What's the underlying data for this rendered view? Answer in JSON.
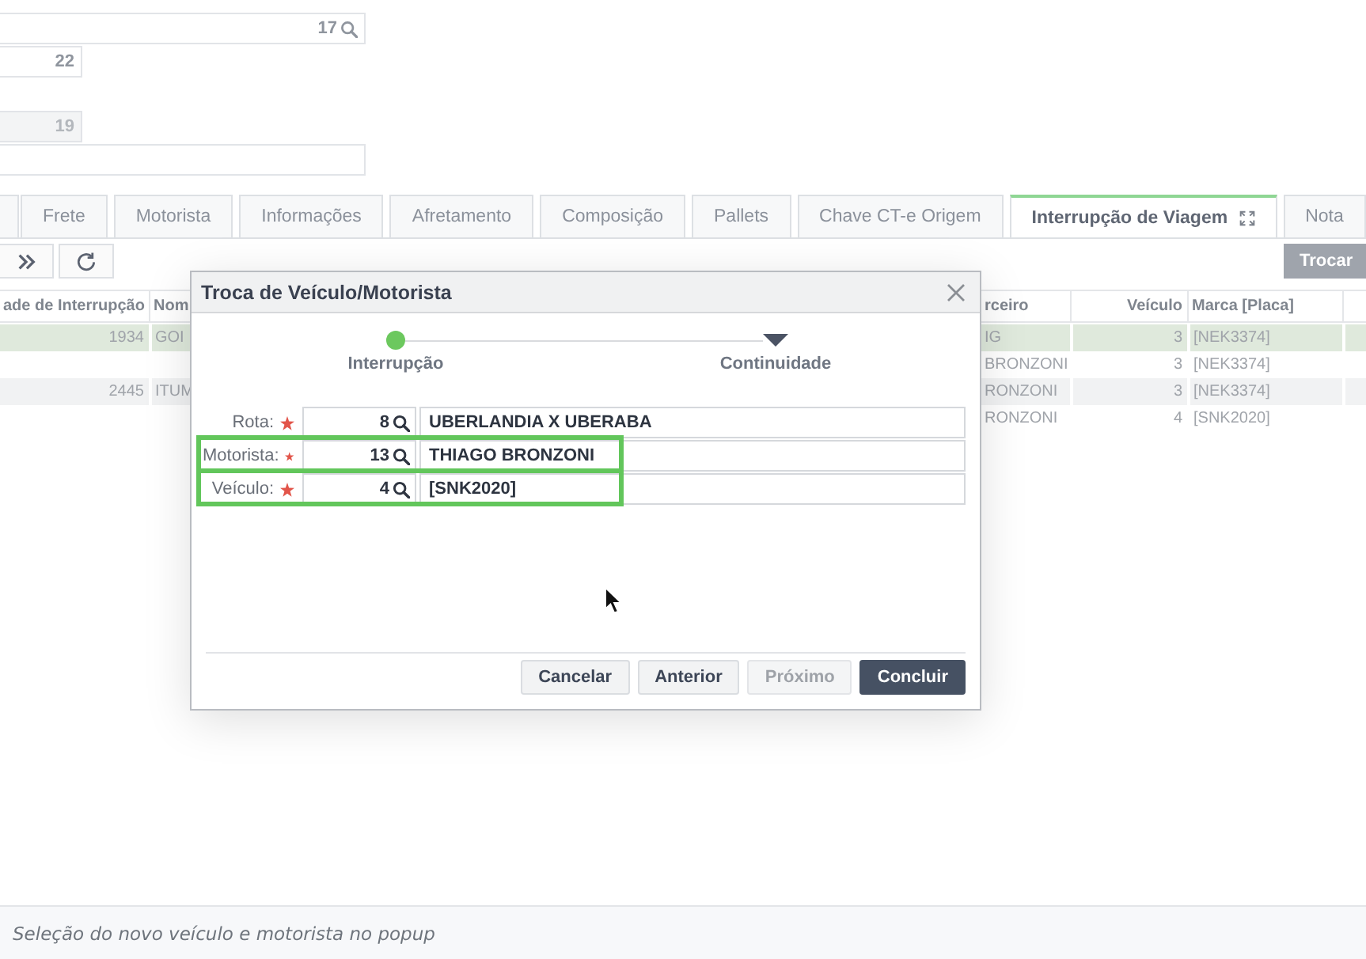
{
  "form_fields": [
    {
      "kind": "lookup",
      "value": "17",
      "disabled": false
    },
    {
      "kind": "number",
      "value": "22",
      "disabled": false
    },
    {
      "kind": "number",
      "value": "19",
      "disabled": true
    },
    {
      "kind": "text",
      "disabled": false
    }
  ],
  "tabs": [
    {
      "label": "Frete",
      "selected": false,
      "expand_icon": false
    },
    {
      "label": "Motorista",
      "selected": false,
      "expand_icon": false
    },
    {
      "label": "Informações",
      "selected": false,
      "expand_icon": false
    },
    {
      "label": "Afretamento",
      "selected": false,
      "expand_icon": false
    },
    {
      "label": "Composição",
      "selected": false,
      "expand_icon": false
    },
    {
      "label": "Pallets",
      "selected": false,
      "expand_icon": false
    },
    {
      "label": "Chave CT-e Origem",
      "selected": false,
      "expand_icon": false
    },
    {
      "label": "Interrupção de Viagem",
      "selected": true,
      "expand_icon": true
    },
    {
      "label": "Nota",
      "selected": false,
      "expand_icon": false
    }
  ],
  "toolbar": {
    "buttons": [
      {
        "kind": "next"
      },
      {
        "kind": "refresh"
      }
    ],
    "action_button": "Trocar"
  },
  "table": {
    "columns": [
      "ade de Interrupção",
      "Nom",
      "rceiro",
      "Veículo",
      "Marca [Placa]"
    ],
    "rows": [
      {
        "selected": true,
        "cells": [
          "1934",
          "GOI",
          "IG",
          "3",
          "[NEK3374]"
        ]
      },
      {
        "selected": false,
        "cells": [
          null,
          null,
          "BRONZONI",
          "3",
          "[NEK3374]"
        ]
      },
      {
        "selected": false,
        "cells": [
          "2445",
          "ITUM",
          "RONZONI",
          "3",
          "[NEK3374]"
        ]
      },
      {
        "selected": false,
        "cells": [
          null,
          null,
          "RONZONI",
          "4",
          "[SNK2020]"
        ]
      }
    ]
  },
  "dialog": {
    "title": "Troca de Veículo/Motorista",
    "steps": [
      {
        "label": "Interrupção",
        "done": true,
        "selected": false
      },
      {
        "label": "Continuidade",
        "done": false,
        "selected": true
      }
    ],
    "rows": [
      {
        "label": "Rota:",
        "required": true,
        "code": "8",
        "description": "UBERLANDIA X UBERABA",
        "highlighted": false
      },
      {
        "label": "Motorista:",
        "required": true,
        "code": "13",
        "description": "THIAGO BRONZONI",
        "highlighted": true
      },
      {
        "label": "Veículo:",
        "required": true,
        "code": "4",
        "description": "[SNK2020]",
        "highlighted": true
      }
    ],
    "buttons": [
      {
        "label": "Cancelar",
        "kind": "secondary",
        "disabled": false
      },
      {
        "label": "Anterior",
        "kind": "secondary",
        "disabled": false
      },
      {
        "label": "Próximo",
        "kind": "secondary",
        "disabled": true
      },
      {
        "label": "Concluir",
        "kind": "primary",
        "disabled": false
      }
    ]
  },
  "caption": "Seleção do novo veículo e motorista no popup"
}
